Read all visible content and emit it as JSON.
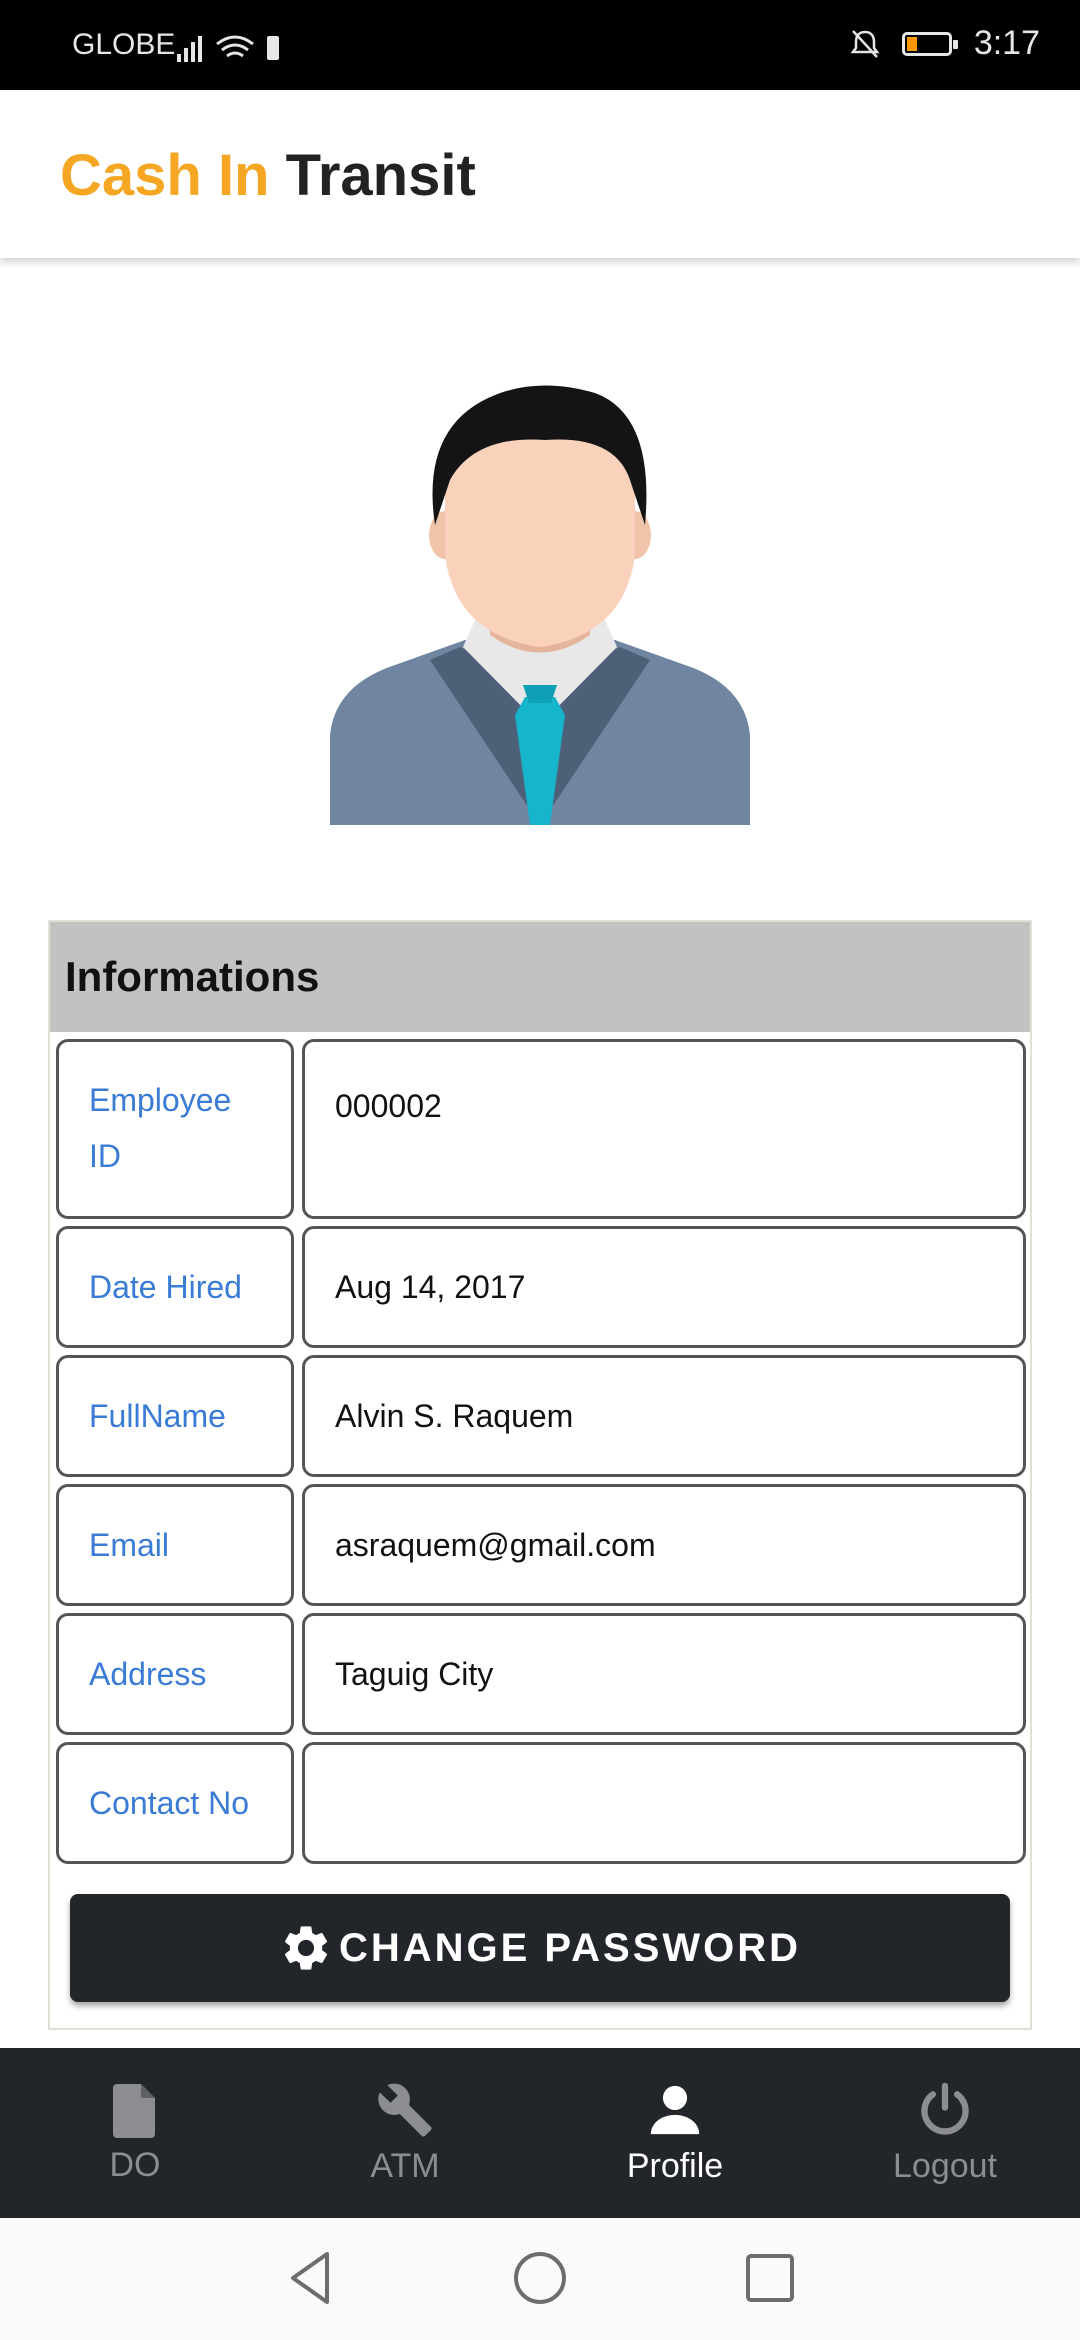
{
  "status_bar": {
    "carrier": "GLOBE",
    "time": "3:17"
  },
  "app": {
    "title_part1": "Cash In",
    "title_part2": "Transit"
  },
  "card": {
    "header": "Informations",
    "rows": [
      {
        "label": "Employee ID",
        "value": "000002"
      },
      {
        "label": "Date Hired",
        "value": "Aug 14, 2017"
      },
      {
        "label": "FullName",
        "value": "Alvin S. Raquem"
      },
      {
        "label": "Email",
        "value": "asraquem@gmail.com"
      },
      {
        "label": "Address",
        "value": "Taguig City"
      },
      {
        "label": "Contact No",
        "value": ""
      }
    ],
    "button_label": "CHANGE PASSWORD"
  },
  "nav": {
    "items": [
      {
        "label": "DO",
        "icon": "file-icon"
      },
      {
        "label": "ATM",
        "icon": "wrench-icon"
      },
      {
        "label": "Profile",
        "icon": "person-icon",
        "active": true
      },
      {
        "label": "Logout",
        "icon": "power-icon"
      }
    ]
  },
  "colors": {
    "accent": "#f5a623",
    "label_blue": "#3a7bd5",
    "dark": "#22252a"
  }
}
